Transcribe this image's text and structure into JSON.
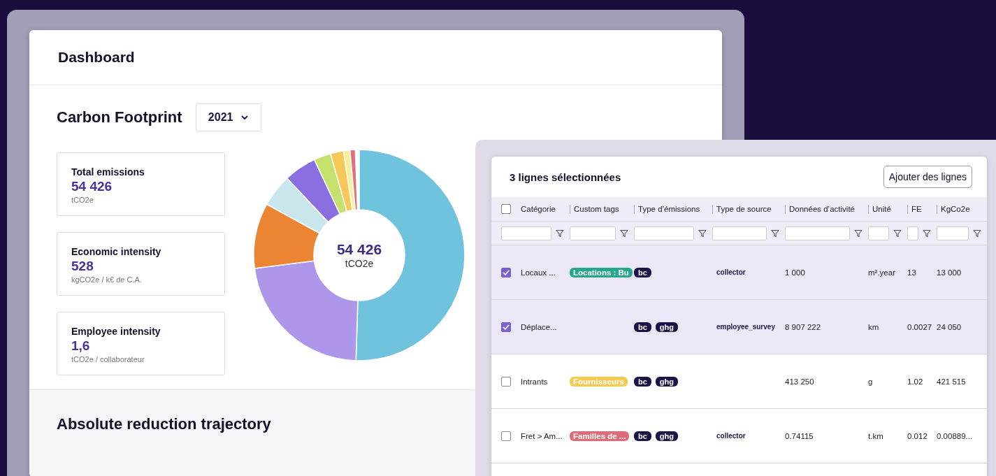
{
  "dashboard": {
    "title": "Dashboard",
    "section_title": "Carbon Footprint",
    "year_select": {
      "value": "2021"
    },
    "kpis": [
      {
        "label": "Total emissions",
        "value": "54 426",
        "unit": "tCO2e"
      },
      {
        "label": "Economic intensity",
        "value": "528",
        "unit": "kgCO2e / k€ de C.A."
      },
      {
        "label": "Employee intensity",
        "value": "1,6",
        "unit": "tCO2e / collaborateur"
      }
    ],
    "donut_center": {
      "value": "54 426",
      "unit": "tCO2e"
    },
    "lower_section_title": "Absolute reduction trajectory"
  },
  "table_panel": {
    "title": "3 lignes sélectionnées",
    "add_button": "Ajouter des lignes",
    "select_all": {
      "checked": false
    },
    "columns": [
      "Catégorie",
      "Custom tags",
      "Type d’émissions",
      "Type de source",
      "Données d’activité",
      "Unité",
      "FE",
      "KgCo2e"
    ],
    "rows": [
      {
        "selected": true,
        "category": "Locaux ...",
        "tags": [
          {
            "label": "Locations : Bu",
            "color": "#26a68e"
          }
        ],
        "emission_types": [
          "bc"
        ],
        "source": "collector",
        "activity": "1 000",
        "unit": "m².year",
        "fe": "13",
        "kgco2e": "13 000"
      },
      {
        "selected": true,
        "category": "Déplace...",
        "tags": [],
        "emission_types": [
          "bc",
          "ghg"
        ],
        "source": "employee_survey",
        "activity": "8 907 222",
        "unit": "km",
        "fe": "0.0027",
        "kgco2e": "24 050"
      },
      {
        "selected": false,
        "category": "Intrants",
        "tags": [
          {
            "label": "Fournisseurs",
            "color": "#f7c94f"
          }
        ],
        "emission_types": [
          "bc",
          "ghg"
        ],
        "source": "",
        "activity": "413 250",
        "unit": "g",
        "fe": "1.02",
        "kgco2e": "421 515"
      },
      {
        "selected": false,
        "category": "Fret > Am...",
        "tags": [
          {
            "label": "Familles de ...",
            "color": "#e06b78"
          }
        ],
        "emission_types": [
          "bc",
          "ghg"
        ],
        "source": "collector",
        "activity": "0.74115",
        "unit": "t.km",
        "fe": "0.012",
        "kgco2e": "0.00889..."
      }
    ]
  }
}
